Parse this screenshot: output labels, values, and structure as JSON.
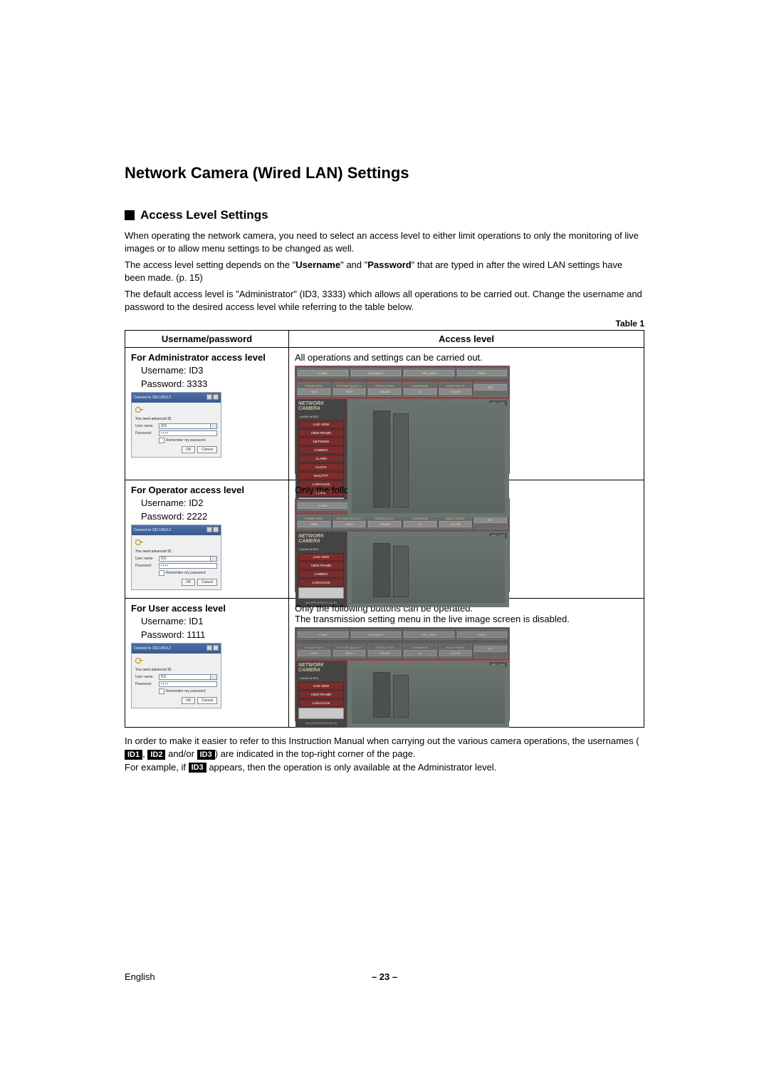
{
  "title": "Network Camera (Wired LAN) Settings",
  "section": "Access Level Settings",
  "para1": "When operating the network camera, you need to select an access level to either limit operations to only the monitoring of live images or to allow menu settings to be changed as well.",
  "para2_a": "The access level setting depends on the \"",
  "para2_b": "Username",
  "para2_c": "\" and \"",
  "para2_d": "Password",
  "para2_e": "\" that are typed in after the wired LAN settings have been made. (p. 15)",
  "para3": "The default access level is \"Administrator\" (ID3, 3333) which allows all operations to be carried out. Change the username and password to the desired access level while referring to the table below.",
  "table_label": "Table 1",
  "th_left": "Username/password",
  "th_right": "Access level",
  "rows": [
    {
      "head": "For Administrator access level",
      "user_line": "Username: ID3",
      "pass_line": "Password: 3333",
      "right_text": "All operations and settings can be carried out.",
      "login": {
        "title": "Connect to 192.168.0.2",
        "need": "You need advanced ID.",
        "user_lbl": "User name:",
        "user_val": "ID3",
        "pass_lbl": "Password:",
        "pass_val": "••••",
        "remember": "Remember my password",
        "ok": "OK",
        "cancel": "Cancel"
      },
      "menu": [
        "LIVE VIEW",
        "VIEW FRAME",
        "NETWORK",
        "CAMERA",
        "ALARM",
        "CLOCK",
        "MAIL/FTP",
        "LANGUAGE",
        "ADMIN"
      ]
    },
    {
      "head": "For Operator access level",
      "user_line": "Username: ID2",
      "pass_line": "Password: 2222",
      "right_text": "Only the following buttons can be operated.",
      "login": {
        "title": "Connect to 192.168.0.2",
        "need": "You need advanced ID.",
        "user_lbl": "User name:",
        "user_val": "ID2",
        "pass_lbl": "Password:",
        "pass_val": "••••",
        "remember": "Remember my password",
        "ok": "OK",
        "cancel": "Cancel"
      },
      "menu": [
        "LIVE VIEW",
        "VIEW FRAME",
        "CAMERA",
        "LANGUAGE"
      ]
    },
    {
      "head": "For User access level",
      "user_line": "Username: ID1",
      "pass_line": "Password: 1111",
      "right_text": "Only the following buttons can be operated.",
      "right_text2": "The transmission setting menu in the live image screen is disabled.",
      "login": {
        "title": "Connect to 192.168.0.2",
        "need": "You need advanced ID.",
        "user_lbl": "User name:",
        "user_val": "ID1",
        "pass_lbl": "Password:",
        "pass_val": "••••",
        "remember": "Remember my password",
        "ok": "OK",
        "cancel": "Cancel"
      },
      "menu": [
        "LIVE VIEW",
        "VIEW FRAME",
        "LANGUAGE"
      ]
    }
  ],
  "cam": {
    "logo1": "NETWORK",
    "logo2": "CAMERA",
    "audio": "♪ AUDIO  ● REC",
    "netcam": "NET_CAM",
    "plugin": "Get JPEG2000 PLUG-IN",
    "tabs": [
      "FRAME RATE",
      "PICTURE QUALITY",
      "RESOLUTION",
      "EXPANSION",
      "IMAGE MODE"
    ],
    "tab_vals": [
      "HIGH",
      "HIGH",
      "720x480",
      "x1",
      "COLOR",
      "SET"
    ],
    "top_tabs": [
      "1 CAM",
      "4CH MULTI",
      "NET_CAM",
      "PAGE"
    ]
  },
  "after1": "In order to make it easier to refer to this Instruction Manual when carrying out the various camera operations, the usernames (",
  "badge1": "ID1",
  "comma": ", ",
  "badge2": "ID2",
  "andor": " and/or ",
  "badge3": "ID3",
  "after2": ") are indicated in the top-right corner of the page.",
  "after3a": "For example, if ",
  "after3b": " appears, then the operation is only available at the Administrator level.",
  "footer_lang": "English",
  "footer_page": "– 23 –"
}
